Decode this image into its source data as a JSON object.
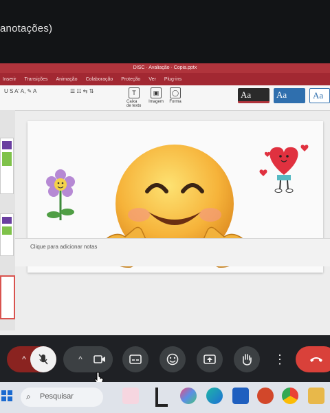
{
  "window": {
    "title": "anotações)"
  },
  "ppt": {
    "doc_title": "DISC · Avaliação · Copia.pptx",
    "tabs": [
      "Inserir",
      "Transições",
      "Animação",
      "Colaboração",
      "Proteção",
      "Ver",
      "Plug-ins"
    ],
    "insert_items": [
      {
        "label": "Caixa de texto",
        "icon": "text-box-icon"
      },
      {
        "label": "Imagem",
        "icon": "image-icon"
      },
      {
        "label": "Forma",
        "icon": "shape-icon"
      }
    ],
    "styles": [
      {
        "text": "Aa",
        "color": "#b0343c"
      },
      {
        "text": "Aa",
        "color": "#2f6fae"
      },
      {
        "text": "Aa",
        "color": "#2f6fae"
      }
    ],
    "notes_placeholder": "Clique para adicionar notas"
  },
  "call": {
    "buttons": [
      "mic-off-icon",
      "chevron-up-icon",
      "camera-icon",
      "captions-icon",
      "emoji-icon",
      "present-icon",
      "raise-hand-icon",
      "more-icon",
      "hang-up-icon"
    ]
  },
  "taskbar": {
    "search_placeholder": "Pesquisar"
  }
}
